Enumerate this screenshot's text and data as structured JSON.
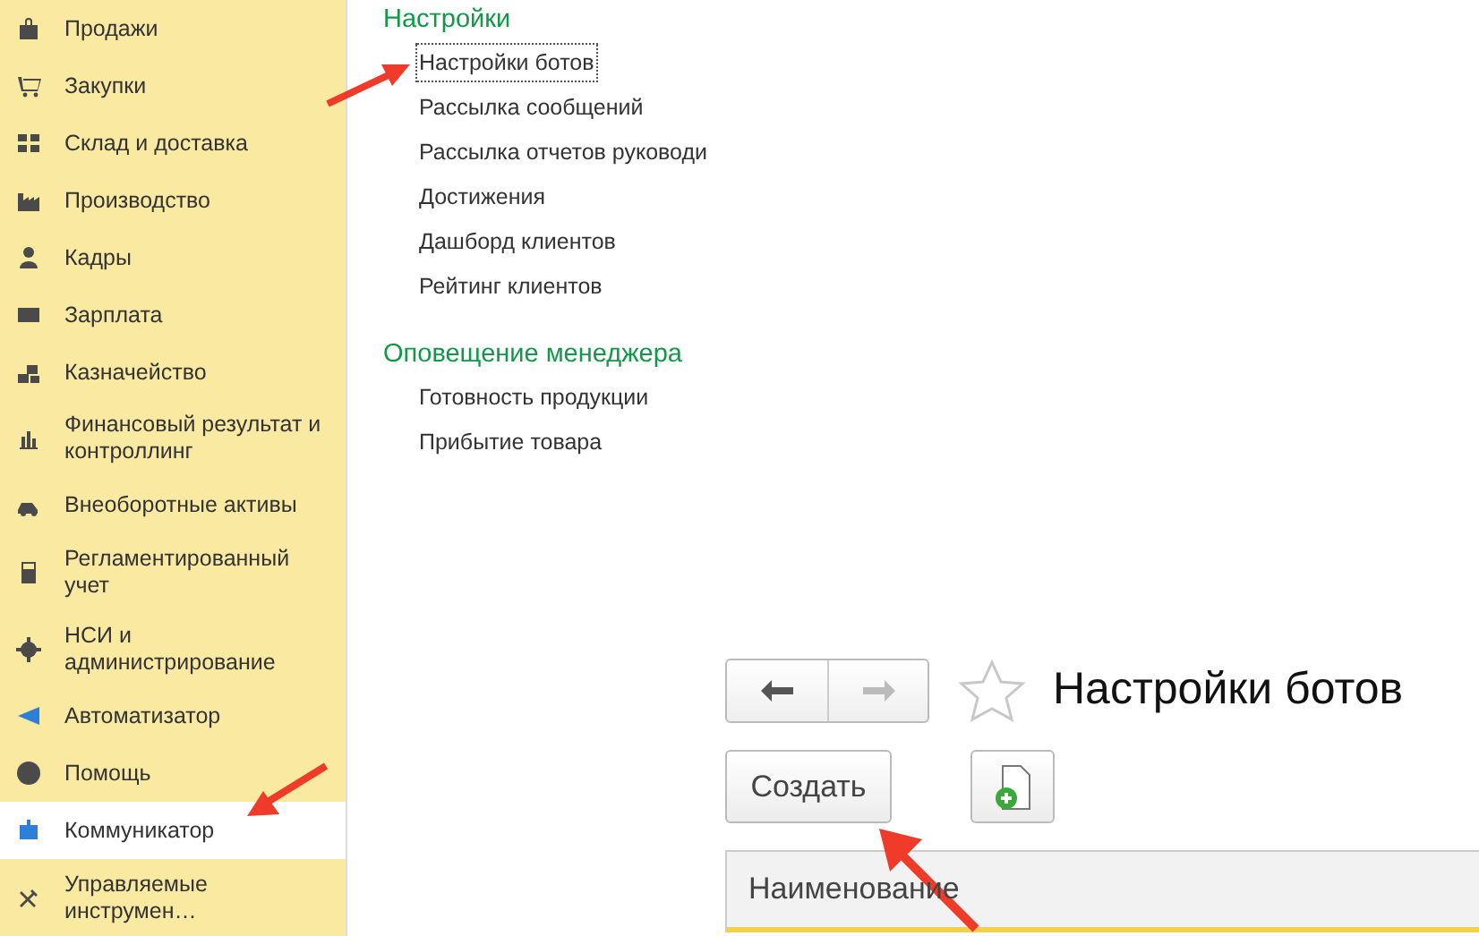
{
  "sidebar": {
    "items": [
      {
        "label": "Продажи",
        "selected": false
      },
      {
        "label": "Закупки",
        "selected": false
      },
      {
        "label": "Склад и доставка",
        "selected": false
      },
      {
        "label": "Производство",
        "selected": false
      },
      {
        "label": "Кадры",
        "selected": false
      },
      {
        "label": "Зарплата",
        "selected": false
      },
      {
        "label": "Казначейство",
        "selected": false
      },
      {
        "label": "Финансовый результат и контроллинг",
        "selected": false
      },
      {
        "label": "Внеоборотные активы",
        "selected": false
      },
      {
        "label": "Регламентированный учет",
        "selected": false
      },
      {
        "label": "НСИ и администрирование",
        "selected": false
      },
      {
        "label": "Автоматизатор",
        "selected": false
      },
      {
        "label": "Помощь",
        "selected": false
      },
      {
        "label": "Коммуникатор",
        "selected": true
      },
      {
        "label": "Управляемые инструмен…",
        "selected": false
      }
    ]
  },
  "sections": [
    {
      "title": "Настройки",
      "links": [
        {
          "label": "Настройки ботов",
          "selected": true
        },
        {
          "label": "Рассылка сообщений",
          "selected": false
        },
        {
          "label": "Рассылка отчетов руководи",
          "selected": false
        },
        {
          "label": "Достижения",
          "selected": false
        },
        {
          "label": "Дашборд клиентов",
          "selected": false
        },
        {
          "label": "Рейтинг клиентов",
          "selected": false
        }
      ]
    },
    {
      "title": "Оповещение менеджера",
      "links": [
        {
          "label": "Готовность продукции",
          "selected": false
        },
        {
          "label": "Прибытие товара",
          "selected": false
        }
      ]
    }
  ],
  "form": {
    "back_disabled": false,
    "forward_disabled": true,
    "favorite": false,
    "title": "Настройки ботов",
    "create_button": "Создать",
    "table": {
      "columns": [
        "Наименование"
      ]
    }
  }
}
